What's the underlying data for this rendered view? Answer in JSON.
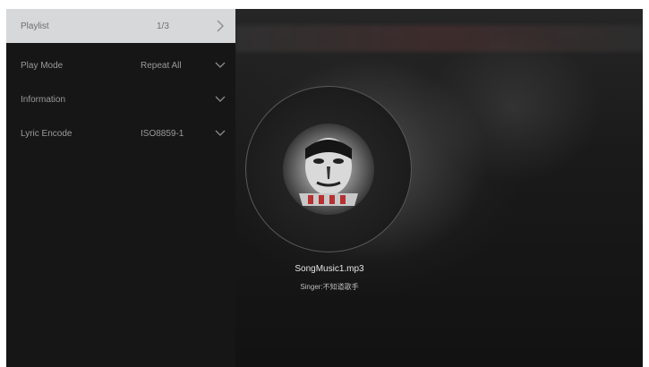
{
  "sidebar": {
    "items": [
      {
        "label": "Playlist",
        "value": "1/3",
        "icon": "chevron-right-icon"
      },
      {
        "label": "Play Mode",
        "value": "Repeat All",
        "icon": "chevron-down-icon"
      },
      {
        "label": "Information",
        "value": "",
        "icon": "chevron-down-icon"
      },
      {
        "label": "Lyric Encode",
        "value": "ISO8859-1",
        "icon": "chevron-down-icon"
      }
    ]
  },
  "player": {
    "song_title": "SongMusic1.mp3",
    "singer": "Singer:不知道歌手"
  },
  "colors": {
    "sidebar_bg": "#161616",
    "active_row_bg": "#d7d8da",
    "screen_bg": "#0c0c0c"
  }
}
